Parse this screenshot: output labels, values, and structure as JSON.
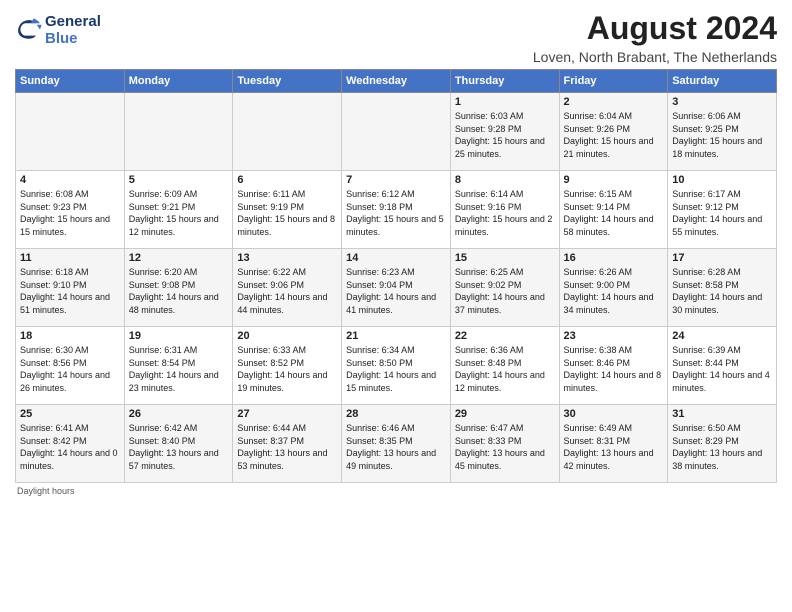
{
  "header": {
    "logo_text_general": "General",
    "logo_text_blue": "Blue",
    "month_title": "August 2024",
    "location": "Loven, North Brabant, The Netherlands"
  },
  "columns": [
    "Sunday",
    "Monday",
    "Tuesday",
    "Wednesday",
    "Thursday",
    "Friday",
    "Saturday"
  ],
  "weeks": [
    [
      {
        "day": "",
        "sunrise": "",
        "sunset": "",
        "daylight": ""
      },
      {
        "day": "",
        "sunrise": "",
        "sunset": "",
        "daylight": ""
      },
      {
        "day": "",
        "sunrise": "",
        "sunset": "",
        "daylight": ""
      },
      {
        "day": "",
        "sunrise": "",
        "sunset": "",
        "daylight": ""
      },
      {
        "day": "1",
        "sunrise": "Sunrise: 6:03 AM",
        "sunset": "Sunset: 9:28 PM",
        "daylight": "Daylight: 15 hours and 25 minutes."
      },
      {
        "day": "2",
        "sunrise": "Sunrise: 6:04 AM",
        "sunset": "Sunset: 9:26 PM",
        "daylight": "Daylight: 15 hours and 21 minutes."
      },
      {
        "day": "3",
        "sunrise": "Sunrise: 6:06 AM",
        "sunset": "Sunset: 9:25 PM",
        "daylight": "Daylight: 15 hours and 18 minutes."
      }
    ],
    [
      {
        "day": "4",
        "sunrise": "Sunrise: 6:08 AM",
        "sunset": "Sunset: 9:23 PM",
        "daylight": "Daylight: 15 hours and 15 minutes."
      },
      {
        "day": "5",
        "sunrise": "Sunrise: 6:09 AM",
        "sunset": "Sunset: 9:21 PM",
        "daylight": "Daylight: 15 hours and 12 minutes."
      },
      {
        "day": "6",
        "sunrise": "Sunrise: 6:11 AM",
        "sunset": "Sunset: 9:19 PM",
        "daylight": "Daylight: 15 hours and 8 minutes."
      },
      {
        "day": "7",
        "sunrise": "Sunrise: 6:12 AM",
        "sunset": "Sunset: 9:18 PM",
        "daylight": "Daylight: 15 hours and 5 minutes."
      },
      {
        "day": "8",
        "sunrise": "Sunrise: 6:14 AM",
        "sunset": "Sunset: 9:16 PM",
        "daylight": "Daylight: 15 hours and 2 minutes."
      },
      {
        "day": "9",
        "sunrise": "Sunrise: 6:15 AM",
        "sunset": "Sunset: 9:14 PM",
        "daylight": "Daylight: 14 hours and 58 minutes."
      },
      {
        "day": "10",
        "sunrise": "Sunrise: 6:17 AM",
        "sunset": "Sunset: 9:12 PM",
        "daylight": "Daylight: 14 hours and 55 minutes."
      }
    ],
    [
      {
        "day": "11",
        "sunrise": "Sunrise: 6:18 AM",
        "sunset": "Sunset: 9:10 PM",
        "daylight": "Daylight: 14 hours and 51 minutes."
      },
      {
        "day": "12",
        "sunrise": "Sunrise: 6:20 AM",
        "sunset": "Sunset: 9:08 PM",
        "daylight": "Daylight: 14 hours and 48 minutes."
      },
      {
        "day": "13",
        "sunrise": "Sunrise: 6:22 AM",
        "sunset": "Sunset: 9:06 PM",
        "daylight": "Daylight: 14 hours and 44 minutes."
      },
      {
        "day": "14",
        "sunrise": "Sunrise: 6:23 AM",
        "sunset": "Sunset: 9:04 PM",
        "daylight": "Daylight: 14 hours and 41 minutes."
      },
      {
        "day": "15",
        "sunrise": "Sunrise: 6:25 AM",
        "sunset": "Sunset: 9:02 PM",
        "daylight": "Daylight: 14 hours and 37 minutes."
      },
      {
        "day": "16",
        "sunrise": "Sunrise: 6:26 AM",
        "sunset": "Sunset: 9:00 PM",
        "daylight": "Daylight: 14 hours and 34 minutes."
      },
      {
        "day": "17",
        "sunrise": "Sunrise: 6:28 AM",
        "sunset": "Sunset: 8:58 PM",
        "daylight": "Daylight: 14 hours and 30 minutes."
      }
    ],
    [
      {
        "day": "18",
        "sunrise": "Sunrise: 6:30 AM",
        "sunset": "Sunset: 8:56 PM",
        "daylight": "Daylight: 14 hours and 26 minutes."
      },
      {
        "day": "19",
        "sunrise": "Sunrise: 6:31 AM",
        "sunset": "Sunset: 8:54 PM",
        "daylight": "Daylight: 14 hours and 23 minutes."
      },
      {
        "day": "20",
        "sunrise": "Sunrise: 6:33 AM",
        "sunset": "Sunset: 8:52 PM",
        "daylight": "Daylight: 14 hours and 19 minutes."
      },
      {
        "day": "21",
        "sunrise": "Sunrise: 6:34 AM",
        "sunset": "Sunset: 8:50 PM",
        "daylight": "Daylight: 14 hours and 15 minutes."
      },
      {
        "day": "22",
        "sunrise": "Sunrise: 6:36 AM",
        "sunset": "Sunset: 8:48 PM",
        "daylight": "Daylight: 14 hours and 12 minutes."
      },
      {
        "day": "23",
        "sunrise": "Sunrise: 6:38 AM",
        "sunset": "Sunset: 8:46 PM",
        "daylight": "Daylight: 14 hours and 8 minutes."
      },
      {
        "day": "24",
        "sunrise": "Sunrise: 6:39 AM",
        "sunset": "Sunset: 8:44 PM",
        "daylight": "Daylight: 14 hours and 4 minutes."
      }
    ],
    [
      {
        "day": "25",
        "sunrise": "Sunrise: 6:41 AM",
        "sunset": "Sunset: 8:42 PM",
        "daylight": "Daylight: 14 hours and 0 minutes."
      },
      {
        "day": "26",
        "sunrise": "Sunrise: 6:42 AM",
        "sunset": "Sunset: 8:40 PM",
        "daylight": "Daylight: 13 hours and 57 minutes."
      },
      {
        "day": "27",
        "sunrise": "Sunrise: 6:44 AM",
        "sunset": "Sunset: 8:37 PM",
        "daylight": "Daylight: 13 hours and 53 minutes."
      },
      {
        "day": "28",
        "sunrise": "Sunrise: 6:46 AM",
        "sunset": "Sunset: 8:35 PM",
        "daylight": "Daylight: 13 hours and 49 minutes."
      },
      {
        "day": "29",
        "sunrise": "Sunrise: 6:47 AM",
        "sunset": "Sunset: 8:33 PM",
        "daylight": "Daylight: 13 hours and 45 minutes."
      },
      {
        "day": "30",
        "sunrise": "Sunrise: 6:49 AM",
        "sunset": "Sunset: 8:31 PM",
        "daylight": "Daylight: 13 hours and 42 minutes."
      },
      {
        "day": "31",
        "sunrise": "Sunrise: 6:50 AM",
        "sunset": "Sunset: 8:29 PM",
        "daylight": "Daylight: 13 hours and 38 minutes."
      }
    ]
  ],
  "footer": "Daylight hours"
}
